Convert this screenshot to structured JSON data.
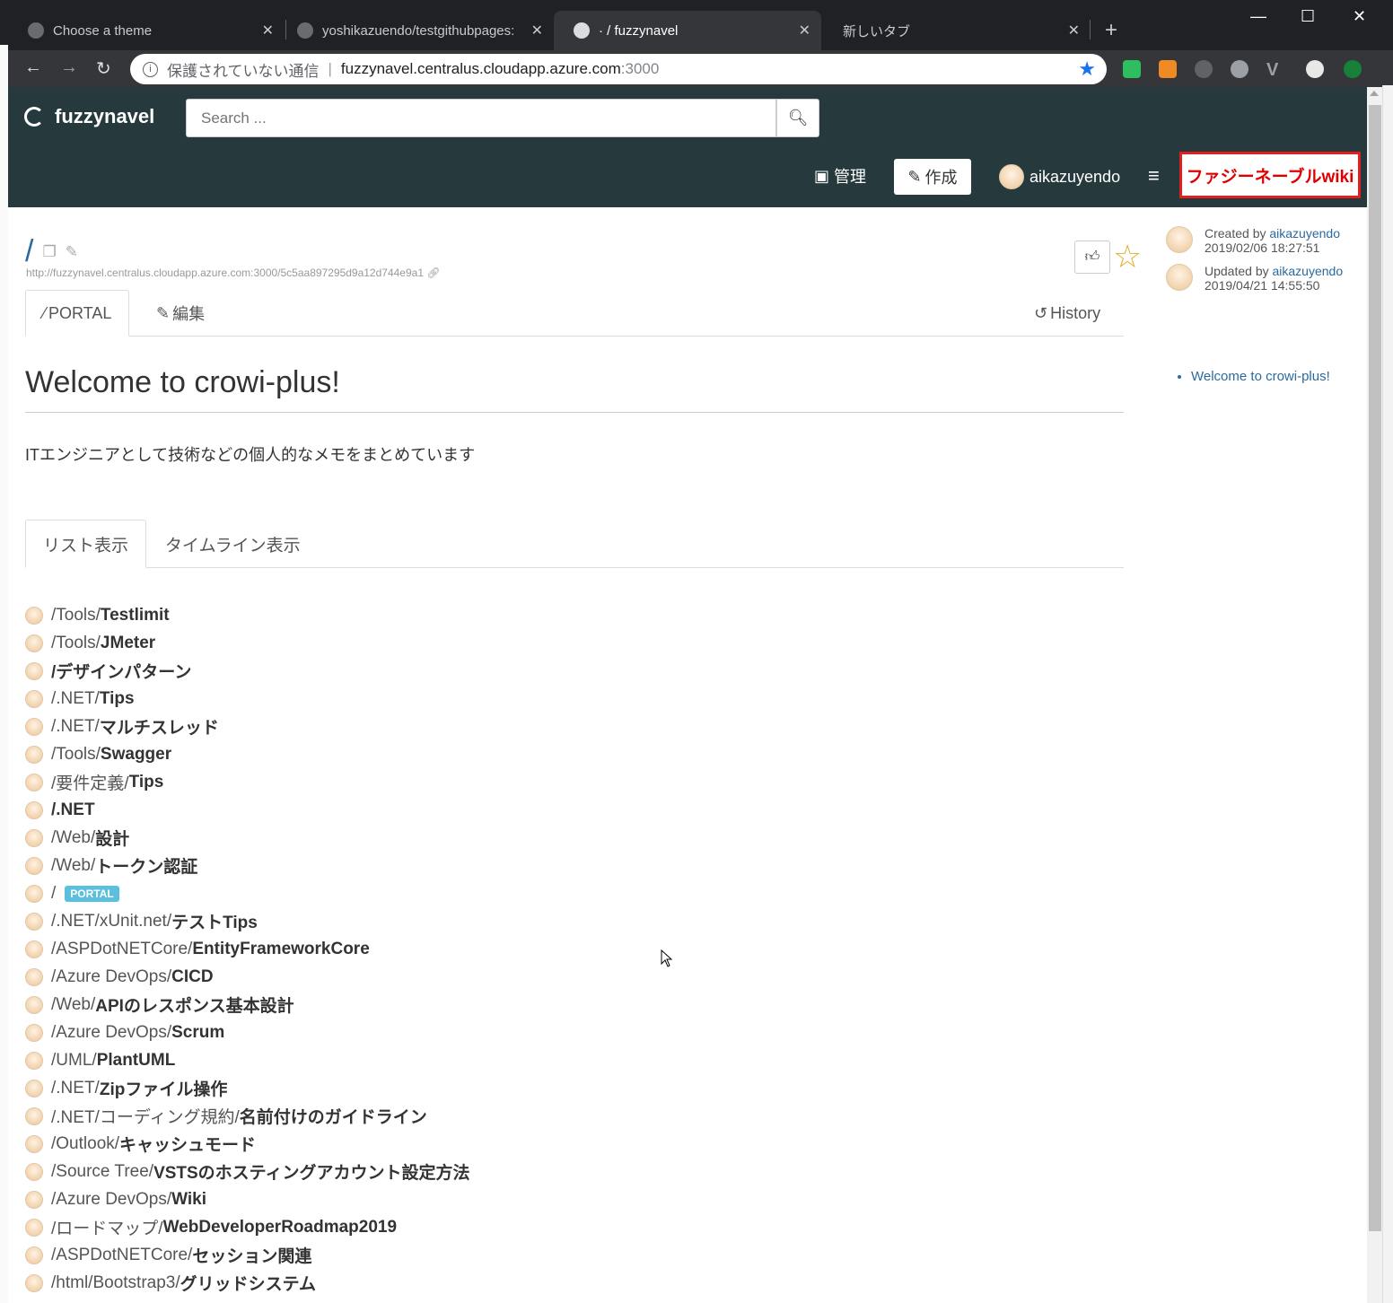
{
  "browser": {
    "tabs": [
      {
        "title": "Choose a theme",
        "active": false
      },
      {
        "title": "yoshikazuendo/testgithubpages:",
        "active": false
      },
      {
        "title": "· / fuzzynavel",
        "active": true
      },
      {
        "title": "新しいタブ",
        "active": false
      }
    ],
    "new_tab": "+",
    "window_controls": {
      "minimize": "—",
      "maximize": "☐",
      "close": "✕"
    },
    "address": {
      "security_label": "保護されていない通信",
      "host": "fuzzynavel.centralus.cloudapp.azure.com",
      "port": ":3000"
    }
  },
  "app": {
    "brand": "fuzzynavel",
    "search_placeholder": "Search ...",
    "nav": {
      "admin": "管理",
      "create": "作成",
      "user": "aikazuyendo",
      "wiki_brand": "ファジーネーブルwiki"
    }
  },
  "page": {
    "path": "/",
    "permalink": "http://fuzzynavel.centralus.cloudapp.azure.com:3000/5c5aa897295d9a12d744e9a1",
    "created": {
      "label": "Created by",
      "user": "aikazuyendo",
      "date": "2019/02/06 18:27:51"
    },
    "updated": {
      "label": "Updated by",
      "user": "aikazuyendo",
      "date": "2019/04/21 14:55:50"
    },
    "tabs": {
      "portal": "PORTAL",
      "edit": "編集",
      "history": "History"
    },
    "title": "Welcome to crowi-plus!",
    "description": "ITエンジニアとして技術などの個人的なメモをまとめています",
    "list_tabs": {
      "list": "リスト表示",
      "timeline": "タイムライン表示"
    },
    "toc": [
      "Welcome to crowi-plus!"
    ],
    "pages": [
      {
        "prefix": "/Tools/",
        "leaf": "Testlimit"
      },
      {
        "prefix": "/Tools/",
        "leaf": "JMeter"
      },
      {
        "prefix": "",
        "leaf": "/デザインパターン"
      },
      {
        "prefix": "/.NET/",
        "leaf": "Tips"
      },
      {
        "prefix": "/.NET/",
        "leaf": "マルチスレッド"
      },
      {
        "prefix": "/Tools/",
        "leaf": "Swagger"
      },
      {
        "prefix": "/要件定義/",
        "leaf": "Tips"
      },
      {
        "prefix": "",
        "leaf": "/.NET"
      },
      {
        "prefix": "/Web/",
        "leaf": "設計"
      },
      {
        "prefix": "/Web/",
        "leaf": "トークン認証"
      },
      {
        "prefix": "/",
        "leaf": "",
        "badge": "PORTAL"
      },
      {
        "prefix": "/.NET/xUnit.net/",
        "leaf": "テストTips"
      },
      {
        "prefix": "/ASPDotNETCore/",
        "leaf": "EntityFrameworkCore"
      },
      {
        "prefix": "/Azure DevOps/",
        "leaf": "CICD"
      },
      {
        "prefix": "/Web/",
        "leaf": "APIのレスポンス基本設計"
      },
      {
        "prefix": "/Azure DevOps/",
        "leaf": "Scrum"
      },
      {
        "prefix": "/UML/",
        "leaf": "PlantUML"
      },
      {
        "prefix": "/.NET/",
        "leaf": "Zipファイル操作"
      },
      {
        "prefix": "/.NET/コーディング規約/",
        "leaf": "名前付けのガイドライン"
      },
      {
        "prefix": "/Outlook/",
        "leaf": "キャッシュモード"
      },
      {
        "prefix": "/Source Tree/",
        "leaf": "VSTSのホスティングアカウント設定方法"
      },
      {
        "prefix": "/Azure DevOps/",
        "leaf": "Wiki"
      },
      {
        "prefix": "/ロードマップ/",
        "leaf": "WebDeveloperRoadmap2019"
      },
      {
        "prefix": "/ASPDotNETCore/",
        "leaf": "セッション関連"
      },
      {
        "prefix": "/html/Bootstrap3/",
        "leaf": "グリッドシステム"
      }
    ]
  },
  "colors": {
    "header_bg": "#263a3d",
    "tabstrip_bg": "#202124",
    "toolbar_bg": "#35363a",
    "link": "#2b6a9e",
    "wiki_brand_red": "#e00000",
    "badge": "#5bc0de"
  }
}
